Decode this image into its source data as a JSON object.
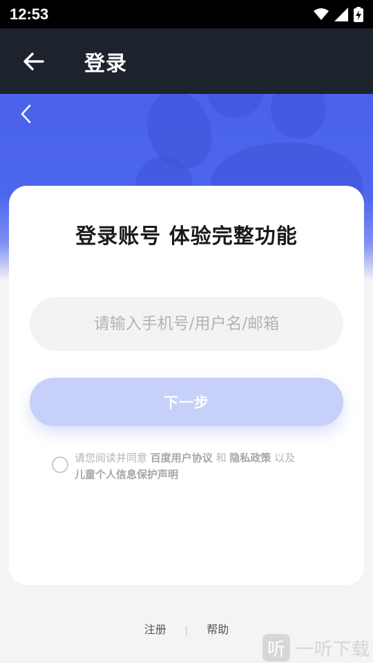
{
  "status_bar": {
    "time": "12:53",
    "icons": [
      "wifi-icon",
      "signal-icon",
      "battery-icon"
    ]
  },
  "app_bar": {
    "back_icon": "arrow-left-icon",
    "title": "登录"
  },
  "hero": {
    "back_icon": "chevron-left-icon",
    "accent_color": "#4d66ee"
  },
  "login_card": {
    "title": "登录账号 体验完整功能",
    "account_input": {
      "value": "",
      "placeholder": "请输入手机号/用户名/邮箱"
    },
    "next_button": {
      "label": "下一步",
      "color": "#c7d0f8"
    },
    "agreement": {
      "checked": false,
      "prefix": "请您阅读并同意",
      "user_agreement": "百度用户协议",
      "and": "和",
      "privacy_policy": "隐私政策",
      "also": "以及",
      "child_protection": "儿童个人信息保护声明"
    }
  },
  "footer": {
    "register_label": "注册",
    "separator": "|",
    "help_label": "帮助"
  },
  "watermark": {
    "logo_glyph": "听",
    "text": "一听下载"
  }
}
